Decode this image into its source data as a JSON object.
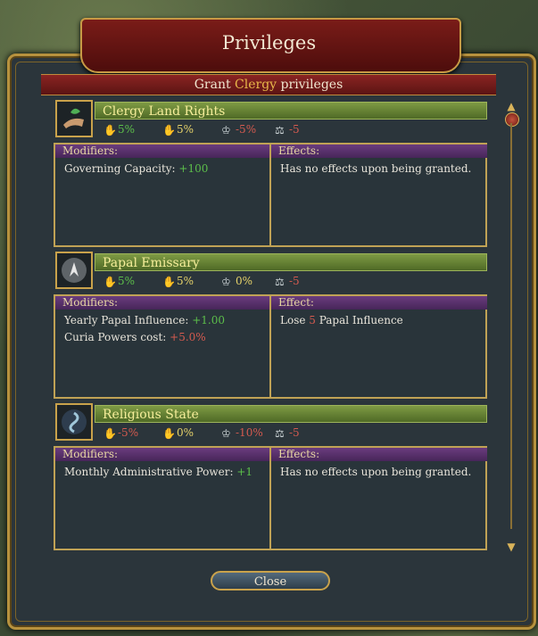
{
  "dialog": {
    "title": "Privileges",
    "grant_prefix": "Grant ",
    "grant_estate": "Clergy",
    "grant_suffix": " privileges",
    "close_label": "Close"
  },
  "privileges": [
    {
      "name": "Clergy Land Rights",
      "icon": "land-grant-icon",
      "stats": {
        "loyalty": "5%",
        "influence": "5%",
        "crown_land": "-5%",
        "max_absolutism": "-5"
      },
      "modifiers_label": "Modifiers:",
      "modifiers": [
        {
          "text": "Governing Capacity: ",
          "value": "+100"
        }
      ],
      "effects_label": "Effects:",
      "effects": "Has no effects upon being granted."
    },
    {
      "name": "Papal Emissary",
      "icon": "papal-seal-icon",
      "stats": {
        "loyalty": "5%",
        "influence": "5%",
        "crown_land": "0%",
        "max_absolutism": "-5"
      },
      "modifiers_label": "Modifiers:",
      "modifiers": [
        {
          "text": "Yearly Papal Influence: ",
          "value": "+1.00"
        },
        {
          "text": "Curia Powers cost: ",
          "value": "+5.0%"
        }
      ],
      "effects_label": "Effect:",
      "effects_prefix": "Lose ",
      "effects_value": "5",
      "effects_suffix": " Papal Influence"
    },
    {
      "name": "Religious State",
      "icon": "religion-icon",
      "stats": {
        "loyalty": "-5%",
        "influence": "0%",
        "crown_land": "-10%",
        "max_absolutism": "-5"
      },
      "modifiers_label": "Modifiers:",
      "modifiers": [
        {
          "text": "Monthly Administrative Power: ",
          "value": "+1"
        }
      ],
      "effects_label": "Effects:",
      "effects": "Has no effects upon being granted."
    }
  ],
  "colors": {
    "positive": "#5cbf4a",
    "negative": "#d45a4f",
    "neutral": "#e7d36a"
  }
}
